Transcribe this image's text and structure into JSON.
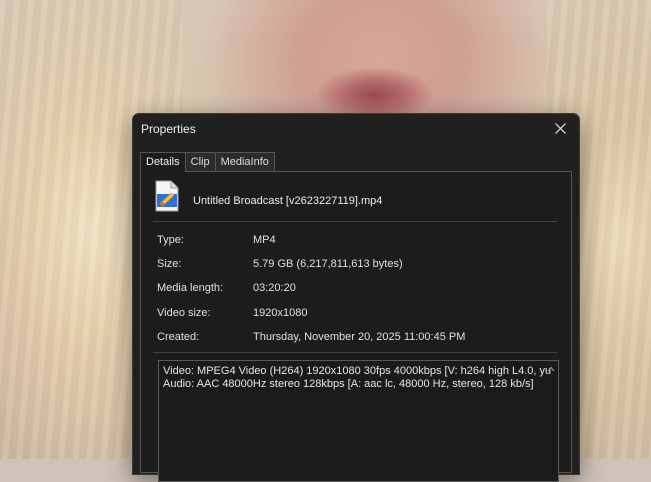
{
  "dialog": {
    "title": "Properties",
    "tabs": [
      "Details",
      "Clip",
      "MediaInfo"
    ],
    "active_tab": "Details",
    "file_name": "Untitled Broadcast [v2623227119].mp4",
    "details": [
      {
        "label": "Type:",
        "value": "MP4"
      },
      {
        "label": "Size:",
        "value": "5.79 GB (6,217,811,613 bytes)"
      },
      {
        "label": "Media length:",
        "value": "03:20:20"
      },
      {
        "label": "Video size:",
        "value": "1920x1080"
      },
      {
        "label": "Created:",
        "value": "Thursday, November 20, 2025 11:00:45 PM"
      }
    ],
    "stream_info": [
      "Video: MPEG4 Video (H264) 1920x1080 30fps 4000kbps [V: h264 high L4.0, yu",
      "Audio: AAC 48000Hz stereo 128kbps [A: aac lc, 48000 Hz, stereo, 128 kb/s]"
    ]
  },
  "icons": {
    "close": "close-icon",
    "file": "media-file-icon",
    "scroll_up": "chevron-up-icon"
  },
  "colors": {
    "dialog_bg": "#202020",
    "panel_bg": "#1c1c1c",
    "icon_accent": "#f0a020"
  }
}
